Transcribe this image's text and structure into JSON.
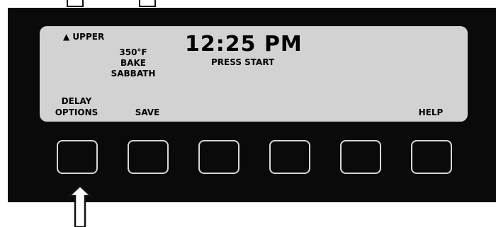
{
  "display": {
    "oven_indicator": "▲ UPPER",
    "temperature": "350°F",
    "mode": "BAKE",
    "sabbath": "SABBATH",
    "time": "12:25 PM",
    "status": "PRESS START"
  },
  "soft_keys": {
    "delay_options_line1": "DELAY",
    "delay_options_line2": "OPTIONS",
    "save": "SAVE",
    "help": "HELP"
  },
  "colors": {
    "panel": "#0a0a0a",
    "lcd": "#d2d2d2",
    "button_outline": "#d8d8d8"
  }
}
